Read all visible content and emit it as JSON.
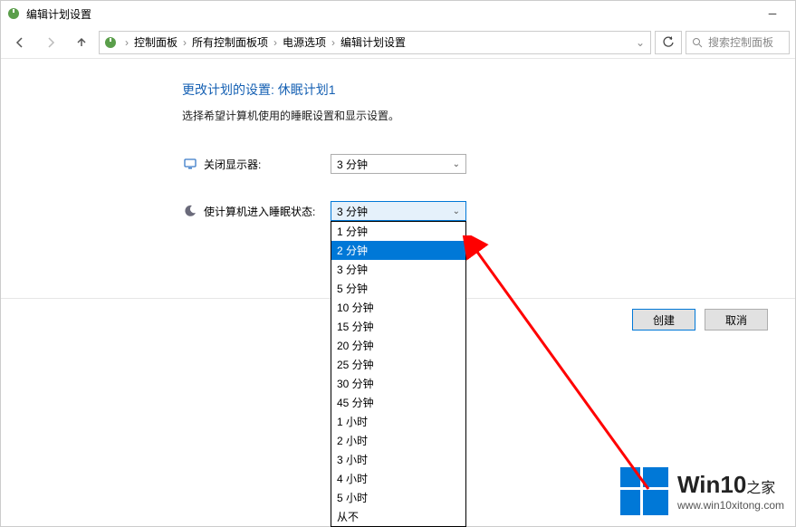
{
  "window": {
    "title": "编辑计划设置"
  },
  "breadcrumb": {
    "items": [
      "控制面板",
      "所有控制面板项",
      "电源选项",
      "编辑计划设置"
    ]
  },
  "search": {
    "placeholder": "搜索控制面板"
  },
  "page": {
    "title": "更改计划的设置: 休眠计划1",
    "description": "选择希望计算机使用的睡眠设置和显示设置。"
  },
  "settings": {
    "display_off": {
      "label": "关闭显示器:",
      "value": "3 分钟"
    },
    "sleep": {
      "label": "使计算机进入睡眠状态:",
      "value": "3 分钟",
      "options": [
        "1 分钟",
        "2 分钟",
        "3 分钟",
        "5 分钟",
        "10 分钟",
        "15 分钟",
        "20 分钟",
        "25 分钟",
        "30 分钟",
        "45 分钟",
        "1 小时",
        "2 小时",
        "3 小时",
        "4 小时",
        "5 小时",
        "从不"
      ],
      "highlighted_index": 1
    }
  },
  "buttons": {
    "create": "创建",
    "cancel": "取消"
  },
  "watermark": {
    "title_main": "Win10",
    "title_sub": "之家",
    "url": "www.win10xitong.com"
  }
}
